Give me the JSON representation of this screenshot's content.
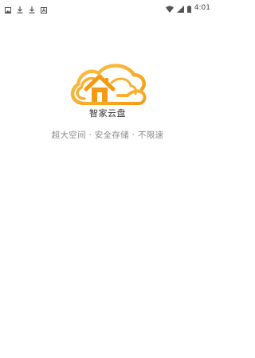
{
  "status_bar": {
    "time": "4:01",
    "left_icons": [
      "image-icon",
      "download-icon",
      "download-icon",
      "text-icon"
    ],
    "right_icons": [
      "wifi-icon",
      "signal-icon",
      "battery-icon"
    ]
  },
  "splash": {
    "app_name": "智家云盘",
    "slogan": "超大空间 · 安全存储 · 不限速"
  },
  "colors": {
    "brand_orange": "#F39A12",
    "brand_orange_light": "#FBC34A",
    "text_dark": "#333333",
    "text_gray": "#8a8a8a"
  }
}
